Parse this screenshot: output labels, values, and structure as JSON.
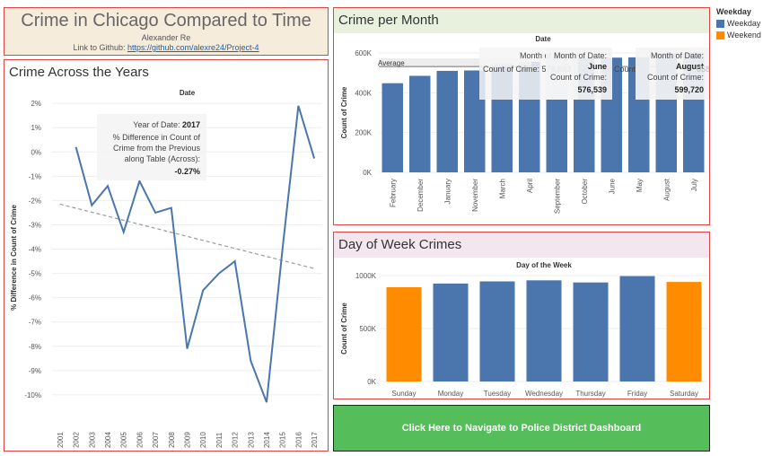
{
  "header": {
    "title": "Crime in Chicago Compared to Time",
    "author": "Alexander Re",
    "link_prefix": "Link to Github: ",
    "link_text": "https://github.com/alexre24/Project-4"
  },
  "legend": {
    "title": "Weekday",
    "items": [
      {
        "label": "Weekday",
        "color": "#4a76ad"
      },
      {
        "label": "Weekend",
        "color": "#ff8c00"
      }
    ]
  },
  "colors": {
    "weekday": "#4a76ad",
    "weekend": "#ff8c00",
    "line": "#4a76ad",
    "nav_button": "#55be5a",
    "panel_border": "#dd4444"
  },
  "nav_button": {
    "label": "Click Here to Navigate to Police District Dashboard"
  },
  "chart_data": [
    {
      "id": "years",
      "type": "line",
      "title": "Crime Across the Years",
      "header": "Date",
      "ylabel": "% Difference in Count of Crime",
      "x": [
        2001,
        2002,
        2003,
        2004,
        2005,
        2006,
        2007,
        2008,
        2009,
        2010,
        2011,
        2012,
        2013,
        2014,
        2015,
        2016,
        2017
      ],
      "values": [
        null,
        0.2,
        -2.2,
        -1.4,
        -3.3,
        -1.2,
        -2.5,
        -2.3,
        -8.1,
        -5.7,
        -5.0,
        -4.5,
        -8.6,
        -10.3,
        -4.0,
        1.9,
        -0.27
      ],
      "ylim": [
        -11,
        2.3
      ],
      "yticks": [
        2,
        1,
        0,
        -1,
        -2,
        -3,
        -4,
        -5,
        -6,
        -7,
        -8,
        -9,
        -10
      ],
      "ytick_labels": [
        "2%",
        "1%",
        "0%",
        "-1%",
        "-2%",
        "-3%",
        "-4%",
        "-5%",
        "-6%",
        "-7%",
        "-8%",
        "-9%",
        "-10%"
      ],
      "trend": {
        "start": -2.15,
        "end": -4.8
      },
      "tooltip": {
        "line1": "Year of Date:",
        "value1": "2017",
        "line2": "% Difference in Count of",
        "line3": "Crime from the Previous",
        "line4": "along Table (Across):",
        "value2": "-0.27%"
      }
    },
    {
      "id": "month",
      "type": "bar",
      "title": "Crime per Month",
      "header": "Date",
      "ylabel": "Count of Crime",
      "categories": [
        "February",
        "December",
        "January",
        "November",
        "March",
        "April",
        "September",
        "October",
        "June",
        "May",
        "August",
        "July"
      ],
      "values": [
        448000,
        485000,
        510000,
        512000,
        548000,
        555000,
        569000,
        574000,
        576539,
        578000,
        599720,
        602000
      ],
      "ylim": [
        0,
        600000
      ],
      "yticks": [
        0,
        200000,
        400000,
        600000
      ],
      "ytick_labels": [
        "0K",
        "200K",
        "400K",
        "600K"
      ],
      "reference": {
        "label": "Average",
        "value": 550000
      },
      "tooltips": [
        {
          "l1": "Month of Date:",
          "v1": "",
          "l2": "Count of Crime:",
          "v2": "578,693"
        },
        {
          "l1": "Month of Date:",
          "v1": "June",
          "l2": "Count of Crime:",
          "v2": "576,539"
        },
        {
          "l1": "Month of Date:",
          "v1": "August",
          "l2": "Count of Crime:",
          "v2": "599,720"
        }
      ],
      "tooltip_fragment": {
        "a": "Count",
        "b": "058"
      }
    },
    {
      "id": "dow",
      "type": "bar",
      "title": "Day of Week Crimes",
      "header": "Day of the Week",
      "ylabel": "Count of Crime",
      "categories": [
        "Sunday",
        "Monday",
        "Tuesday",
        "Wednesday",
        "Thursday",
        "Friday",
        "Saturday"
      ],
      "values": [
        890000,
        925000,
        945000,
        955000,
        935000,
        995000,
        940000
      ],
      "group": [
        "Weekend",
        "Weekday",
        "Weekday",
        "Weekday",
        "Weekday",
        "Weekday",
        "Weekend"
      ],
      "ylim": [
        0,
        1000000
      ],
      "yticks": [
        0,
        500000,
        1000000
      ],
      "ytick_labels": [
        "0K",
        "500K",
        "1000K"
      ]
    }
  ]
}
